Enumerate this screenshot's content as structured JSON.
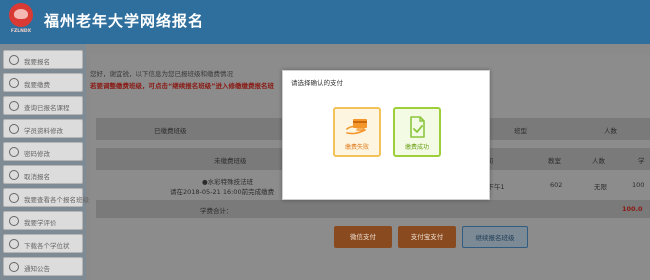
{
  "header": {
    "logo_text": "FZLNDX",
    "site_title": "福州老年大学网络报名"
  },
  "sidebar": {
    "items": [
      {
        "label": "我要报名",
        "icon": "globe-icon"
      },
      {
        "label": "我要缴费",
        "icon": "wallet-icon"
      },
      {
        "label": "查询已报名课程",
        "icon": "search-icon"
      },
      {
        "label": "学员资料修改",
        "icon": "edit-icon"
      },
      {
        "label": "密码修改",
        "icon": "lock-icon"
      },
      {
        "label": "取消报名",
        "icon": "cancel-icon"
      },
      {
        "label": "我要查看各个报名班级",
        "icon": "list-icon"
      },
      {
        "label": "我要学评价",
        "icon": "star-icon"
      },
      {
        "label": "下载各个学位状",
        "icon": "download-icon"
      },
      {
        "label": "通知公告",
        "icon": "bell-icon"
      }
    ]
  },
  "main": {
    "notice1": "您好，谢宜锐，以下信息为您已报班级和缴费情况",
    "notice2_prefix": "若要调整缴费班级，可点击“",
    "notice2_link": "继续报名班级",
    "notice2_suffix": "”进入修缴缴费报名班",
    "paid_label": "已缴费班级",
    "paid_col_class": "班型",
    "paid_col_count": "人数",
    "unpaid_label": "未缴费班级",
    "unpaid_col_time": "时间",
    "unpaid_col_room": "教室",
    "unpaid_col_count": "人数",
    "unpaid_col_fee": "学",
    "row": {
      "course": "●水彩特殊技法班",
      "deadline": "请在2018-05-21 16:00前完成缴费",
      "mode": "另网",
      "time": "星期一下午1",
      "room": "602",
      "count": "无限",
      "fee": "100"
    },
    "total_label": "学费合计：",
    "total_value": "100.0",
    "btn_wechat": "微信支付",
    "btn_alipay": "支付宝支付",
    "btn_continue": "继续报名班级"
  },
  "dialog": {
    "title": "请选择确认的支付",
    "fail_label": "缴费失败",
    "success_label": "缴费成功"
  },
  "colors": {
    "header_blue": "#2f6f9e",
    "orange": "#f5962a",
    "green": "#8cc63e",
    "red_text": "#d02c22"
  }
}
